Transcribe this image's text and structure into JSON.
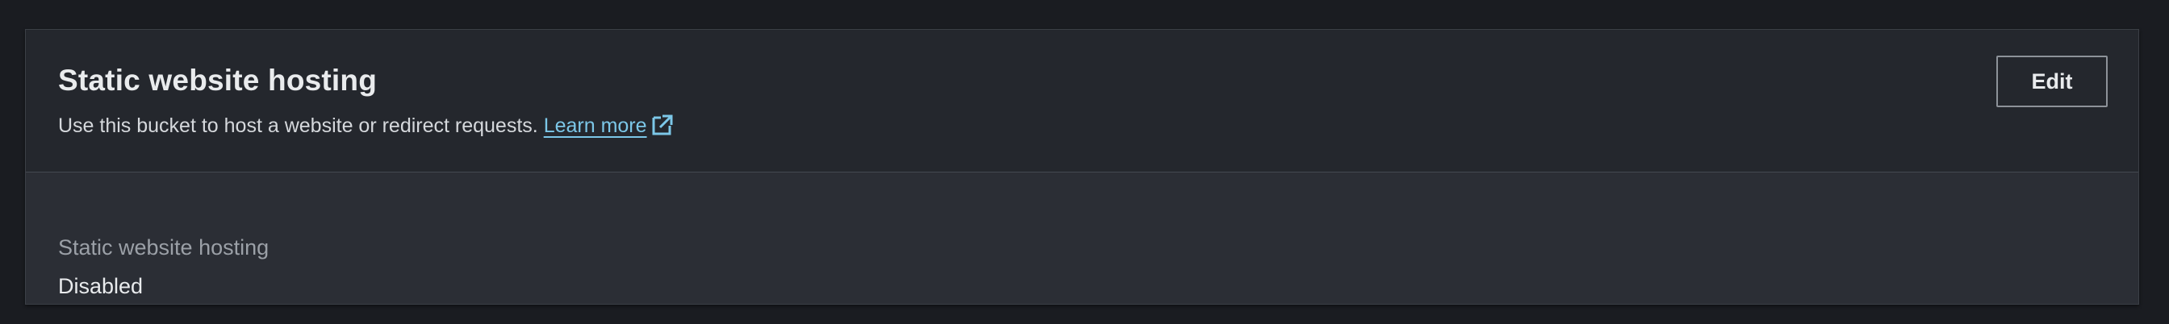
{
  "section": {
    "title": "Static website hosting",
    "description": "Use this bucket to host a website or redirect requests.",
    "learn_more_label": "Learn more",
    "edit_label": "Edit",
    "link_color": "#7cc7e8",
    "external_link_icon": "external-link-icon"
  },
  "details": {
    "label": "Static website hosting",
    "value": "Disabled"
  }
}
